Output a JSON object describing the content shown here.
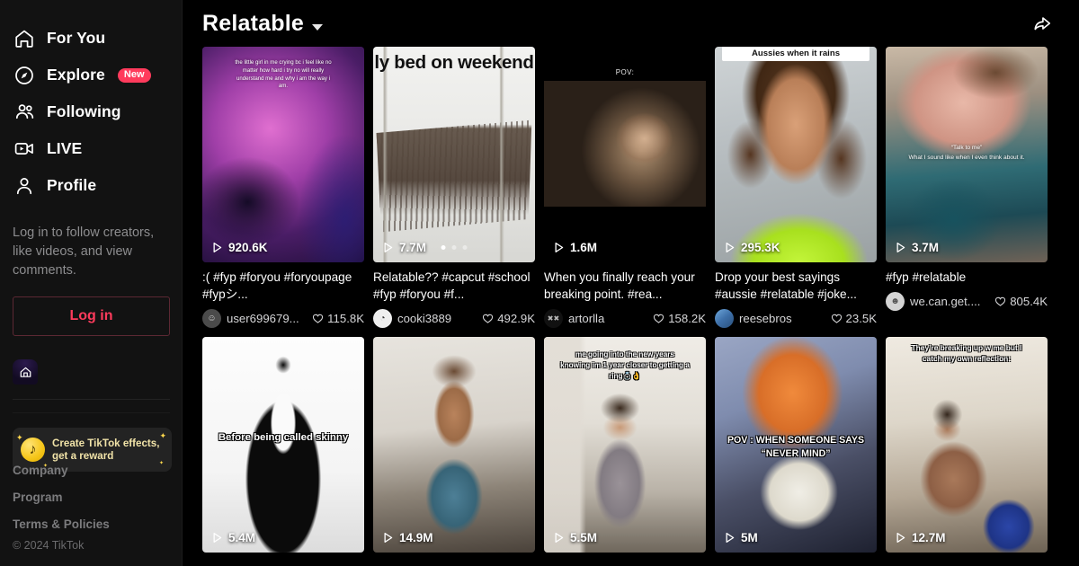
{
  "sidebar": {
    "nav": [
      {
        "label": "For You",
        "icon": "home-icon",
        "badge": null
      },
      {
        "label": "Explore",
        "icon": "compass-icon",
        "badge": "New"
      },
      {
        "label": "Following",
        "icon": "people-icon",
        "badge": null
      },
      {
        "label": "LIVE",
        "icon": "live-video-icon",
        "badge": null
      },
      {
        "label": "Profile",
        "icon": "person-icon",
        "badge": null
      }
    ],
    "login_note": "Log in to follow creators, like videos, and view comments.",
    "login_button": "Log in",
    "effects_banner": {
      "line1": "Create TikTok effects,",
      "line2": "get a reward"
    },
    "footer": {
      "links": [
        "Company",
        "Program",
        "Terms & Policies"
      ],
      "copyright": "© 2024 TikTok"
    }
  },
  "header": {
    "title": "Relatable",
    "caret_icon": "chevron-down-icon",
    "share_icon": "share-arrow-icon"
  },
  "colors": {
    "accent": "#ff3b5c",
    "sidebar_bg": "#121212",
    "main_bg": "#000000",
    "banner_bg": "#232323",
    "banner_text": "#f1e3a8"
  },
  "videos": [
    {
      "plays": "920.6K",
      "caption": ":( #fyp #foryou #foryoupage #fypシ...",
      "username": "user699679...",
      "likes": "115.8K",
      "overlay": "the little girl in me crying bc i feel like no matter how hard i try no will really understand me and why i am the way i am.",
      "overlay_style": "small-center-top",
      "dots": null
    },
    {
      "plays": "7.7M",
      "caption": "Relatable?? #capcut #school #fyp #foryou #f...",
      "username": "cooki3889",
      "likes": "492.9K",
      "overlay": "ly bed on weekend",
      "overlay_style": "big-black-top",
      "dots": 3
    },
    {
      "plays": "1.6M",
      "caption": "When you finally reach your breaking point. #rea...",
      "username": "artorlla",
      "likes": "158.2K",
      "overlay": "POV:",
      "overlay_style": "pov-letterbox",
      "dots": null
    },
    {
      "plays": "295.3K",
      "caption": "Drop your best sayings #aussie #relatable #joke...",
      "username": "reesebros",
      "likes": "23.5K",
      "overlay": "Aussies when it rains",
      "overlay_style": "white-caption-box",
      "dots": null
    },
    {
      "plays": "3.7M",
      "caption": "#fyp #relatable",
      "username": "we.can.get....",
      "likes": "805.4K",
      "overlay": "“Talk to me”\nWhat I sound like when I even think about it.",
      "overlay_style": "small-center-mid",
      "dots": null
    },
    {
      "plays": "5.4M",
      "caption": "",
      "username": "",
      "likes": "",
      "overlay": "Before being called skinny",
      "overlay_style": "outline-mid",
      "dots": null
    },
    {
      "plays": "14.9M",
      "caption": "",
      "username": "",
      "likes": "",
      "overlay": "",
      "overlay_style": "none",
      "dots": null
    },
    {
      "plays": "5.5M",
      "caption": "",
      "username": "",
      "likes": "",
      "overlay": "me going into the new years knowing im 1 year closer to getting a ring💍👌",
      "overlay_style": "outline-top",
      "dots": null
    },
    {
      "plays": "5M",
      "caption": "",
      "username": "",
      "likes": "",
      "overlay": "POV : WHEN SOMEONE SAYS “NEVER MIND”",
      "overlay_style": "outline-mid-caps",
      "dots": null
    },
    {
      "plays": "12.7M",
      "caption": "",
      "username": "",
      "likes": "",
      "overlay": "They’re breaking up w me but I catch my own reflection:",
      "overlay_style": "outline-top",
      "dots": null
    }
  ]
}
